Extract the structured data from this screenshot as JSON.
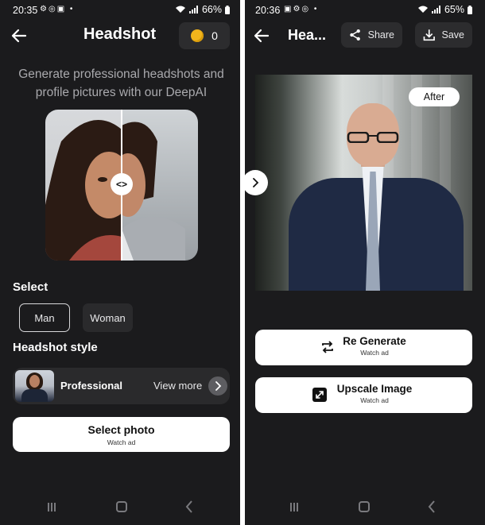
{
  "left": {
    "status": {
      "time": "20:35",
      "battery": "66%"
    },
    "header": {
      "title": "Headshot",
      "coins": "0"
    },
    "subtitle": "Generate professional headshots and profile pictures with our DeepAI",
    "select": {
      "heading": "Select",
      "options": [
        {
          "label": "Man",
          "selected": true
        },
        {
          "label": "Woman",
          "selected": false
        }
      ]
    },
    "style": {
      "heading": "Headshot style",
      "current": "Professional",
      "view_more": "View more"
    },
    "select_photo": {
      "label": "Select photo",
      "sub": "Watch ad"
    }
  },
  "right": {
    "status": {
      "time": "20:36",
      "battery": "65%"
    },
    "header": {
      "title": "Hea...",
      "share": "Share",
      "save": "Save"
    },
    "after_label": "After",
    "regenerate": {
      "label": "Re Generate",
      "sub": "Watch ad"
    },
    "upscale": {
      "label": "Upscale Image",
      "sub": "Watch ad"
    }
  },
  "colors": {
    "background": "#1b1b1d",
    "surface": "#2a2a2c",
    "coin": "#f2b51c",
    "button": "#ffffff"
  },
  "icons": [
    "back-arrow-icon",
    "coin-icon",
    "compare-handle-icon",
    "chevron-right-icon",
    "share-icon",
    "download-icon",
    "repeat-icon",
    "expand-icon",
    "wifi-icon",
    "signal-icon",
    "battery-icon"
  ]
}
